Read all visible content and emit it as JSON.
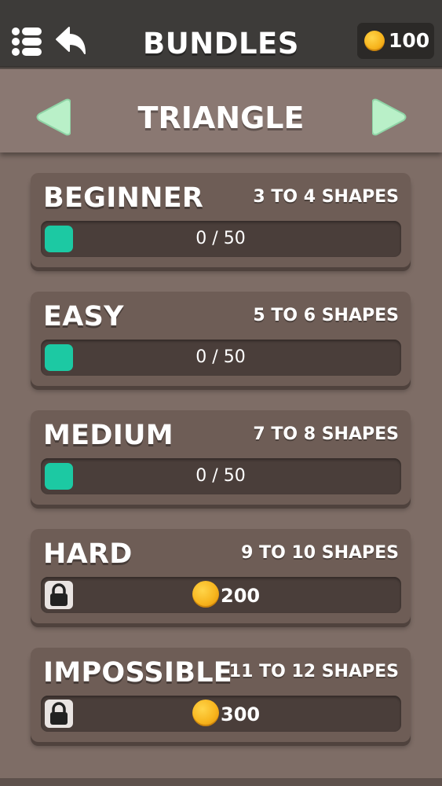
{
  "header": {
    "title": "BUNDLES",
    "coins": "100"
  },
  "category": {
    "name": "TRIANGLE"
  },
  "bundles": [
    {
      "name": "BEGINNER",
      "range": "3 TO 4 SHAPES",
      "locked": false,
      "progress": "0 / 50",
      "completed": 0,
      "total": 50
    },
    {
      "name": "EASY",
      "range": "5 TO 6 SHAPES",
      "locked": false,
      "progress": "0 / 50",
      "completed": 0,
      "total": 50
    },
    {
      "name": "MEDIUM",
      "range": "7 TO 8 SHAPES",
      "locked": false,
      "progress": "0 / 50",
      "completed": 0,
      "total": 50
    },
    {
      "name": "HARD",
      "range": "9 TO 10 SHAPES",
      "locked": true,
      "price": "200"
    },
    {
      "name": "IMPOSSIBLE",
      "range": "11 TO 12 SHAPES",
      "locked": true,
      "price": "300"
    }
  ],
  "colors": {
    "background": "#7e6d66",
    "topbar": "#3d3b39",
    "card": "#6e5d56",
    "track": "#4a3e3a",
    "progress_fill": "#1cc9a3",
    "arrow": "#b9f0c8",
    "coin": "#f7b51e"
  },
  "icons": {
    "menu": "menu-list-icon",
    "back": "back-arrow-icon",
    "coin": "coin-icon",
    "prev": "triangle-left-icon",
    "next": "triangle-right-icon",
    "lock": "lock-icon"
  }
}
